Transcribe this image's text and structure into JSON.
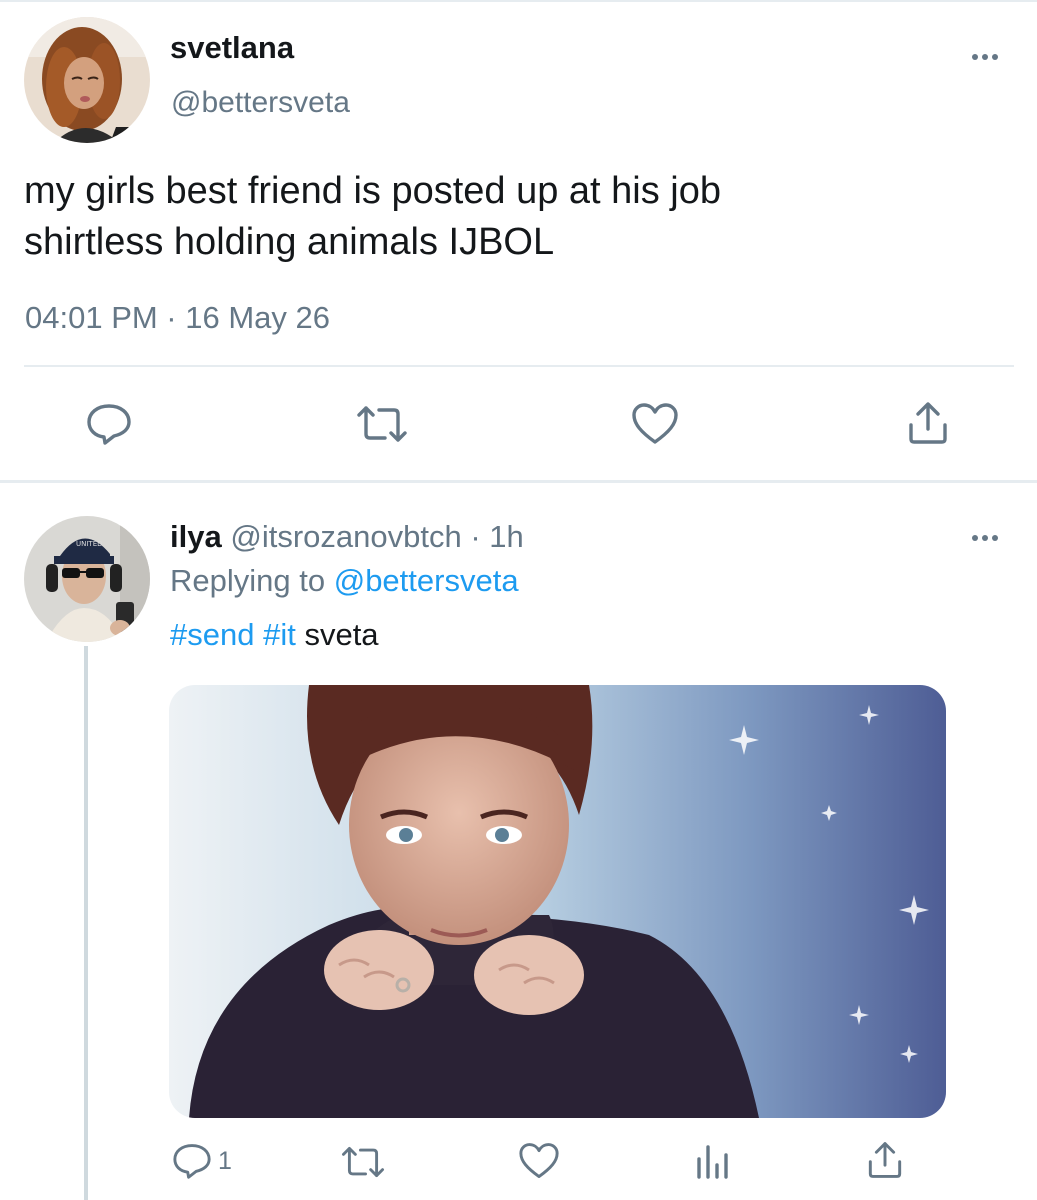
{
  "main_tweet": {
    "display_name": "svetlana",
    "handle": "@bettersveta",
    "text_line1": "my girls best friend is posted up at his job",
    "text_line2": "shirtless holding animals IJBOL",
    "timestamp": "04:01 PM · 16 May 26",
    "actions": [
      "reply-icon",
      "retweet-icon",
      "like-icon",
      "share-icon"
    ]
  },
  "reply": {
    "display_name": "ilya",
    "handle": "@itsrozanovbtch",
    "separator": " · ",
    "time": "1h",
    "replying_prefix": "Replying to ",
    "replying_handle": "@bettersveta",
    "hashtag1": "#send",
    "hashtag2": "#it",
    "text_rest": " sveta",
    "reply_count": "1",
    "actions": [
      "reply-icon",
      "retweet-icon",
      "like-icon",
      "analytics-icon",
      "share-icon"
    ]
  },
  "colors": {
    "text": "#14171a",
    "secondary": "#657786",
    "link": "#1d9bf0",
    "divider": "#e6ecf0"
  }
}
